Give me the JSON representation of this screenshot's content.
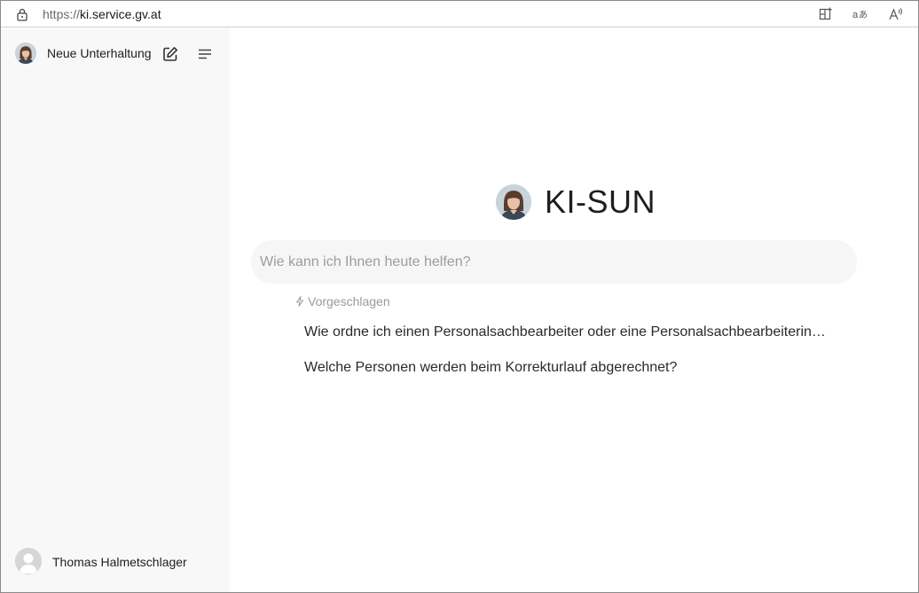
{
  "browser": {
    "url_protocol": "https://",
    "url_host": "ki.service.gv.at",
    "icons": [
      "lock-icon",
      "split-screen-icon",
      "translate-icon",
      "read-aloud-icon"
    ]
  },
  "sidebar": {
    "title": "Neue Unterhaltung",
    "icons": [
      "new-chat-icon",
      "menu-icon"
    ],
    "user_name": "Thomas Halmetschlager"
  },
  "main": {
    "brand": "KI-SUN",
    "input_placeholder": "Wie kann ich Ihnen heute helfen?",
    "suggested_label": "Vorgeschlagen",
    "suggestions": [
      "Wie ordne ich einen Personalsachbearbeiter oder eine Personalsachbearbeiterin…",
      "Welche Personen werden beim Korrekturlauf abgerechnet?"
    ]
  },
  "colors": {
    "sidebar_bg": "#f8f8f8",
    "input_bg": "#f6f6f6",
    "muted_text": "#9a9a9a"
  }
}
